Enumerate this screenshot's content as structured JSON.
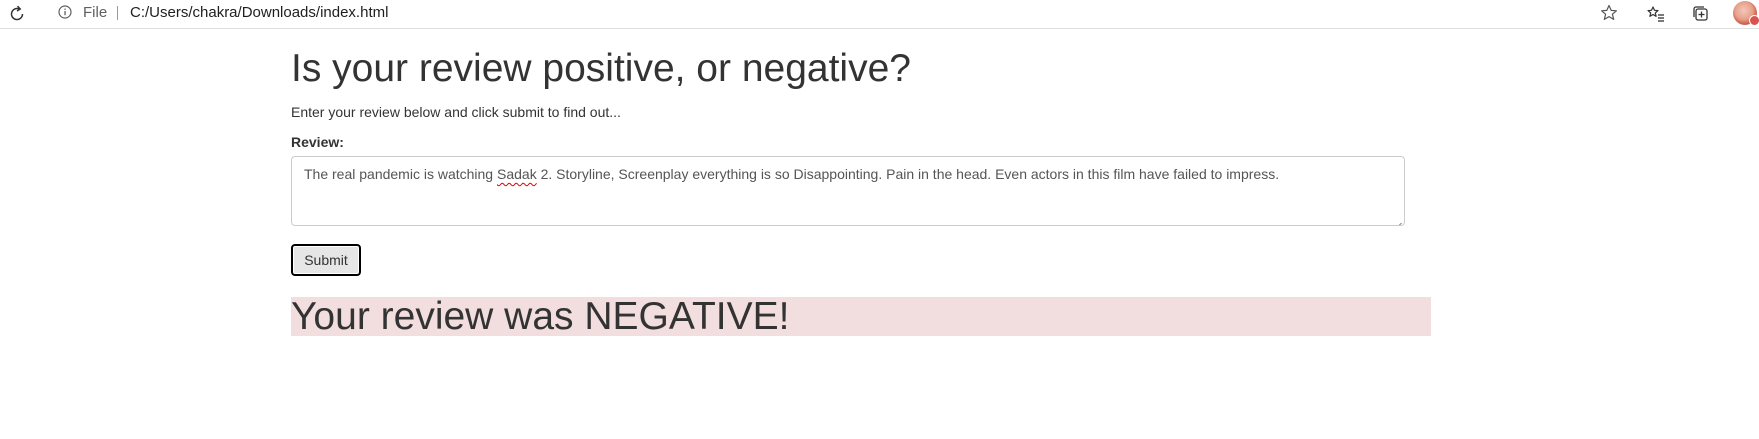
{
  "browser": {
    "scheme_label": "File",
    "url": "C:/Users/chakra/Downloads/index.html"
  },
  "page": {
    "title": "Is your review positive, or negative?",
    "lead": "Enter your review below and click submit to find out...",
    "review_label": "Review:",
    "review_text_before": "The real pandemic is watching ",
    "review_text_misspelled": "Sadak",
    "review_text_after": " 2. Storyline, Screenplay everything is so Disappointing. Pain in the head. Even actors in this film have failed to impress.",
    "submit_label": "Submit",
    "result_text": "Your review was NEGATIVE!"
  },
  "colors": {
    "result_background": "#f2dede",
    "text": "#333333",
    "spellcheck_underline": "#e00000"
  },
  "icons": {
    "reload": "reload-icon",
    "info": "info-icon",
    "favorite": "star-icon",
    "favorites_bar": "favorites-icon",
    "collections": "collections-icon",
    "profile": "avatar"
  }
}
